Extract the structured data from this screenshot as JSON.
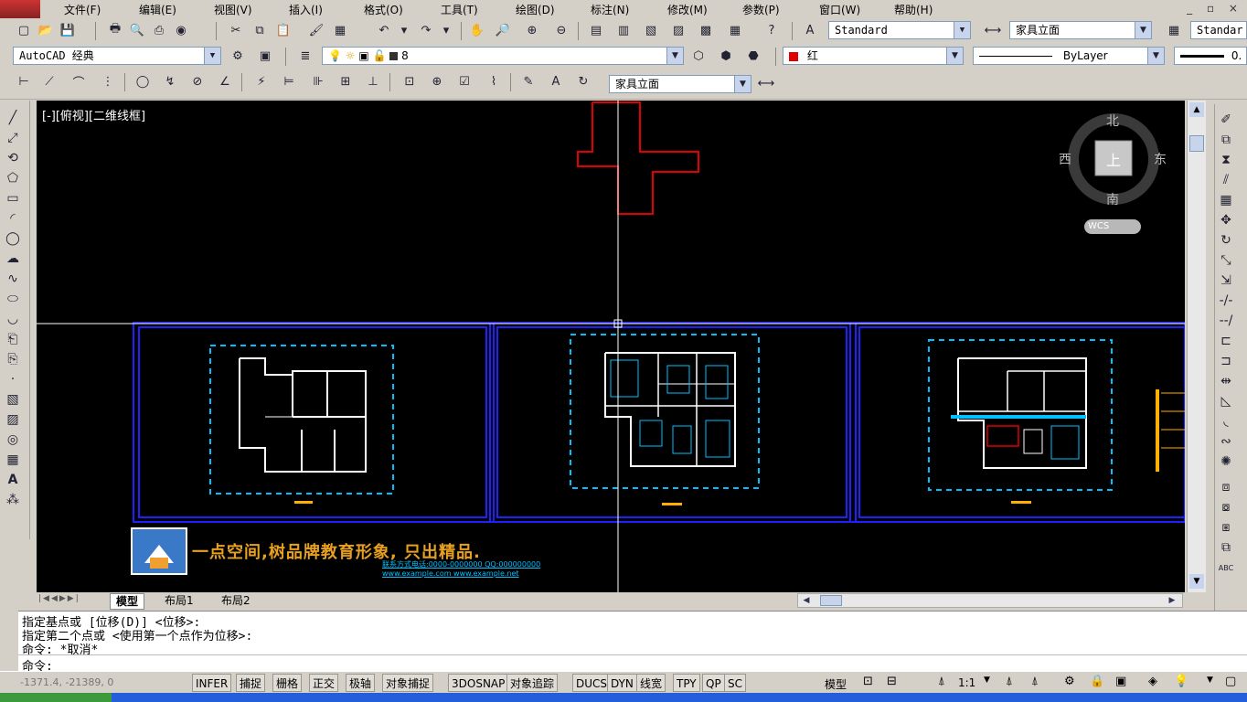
{
  "menu": {
    "items": [
      "文件(F)",
      "编辑(E)",
      "视图(V)",
      "插入(I)",
      "格式(O)",
      "工具(T)",
      "绘图(D)",
      "标注(N)",
      "修改(M)",
      "参数(P)",
      "窗口(W)",
      "帮助(H)"
    ],
    "window_controls": "_ ▫ ×"
  },
  "toolbar": {
    "text_style": "Standard",
    "dim_style": "家具立面",
    "table_style": "Standar",
    "workspace": "AutoCAD 经典",
    "layer": "8",
    "color": "红",
    "linetype": "ByLayer",
    "lineweight": "0.",
    "multileader_style": "家具立面",
    "colors": {
      "red": "#e00000",
      "canvas": "#000000",
      "cyan": "#00c0ff",
      "blue": "#2020ff"
    }
  },
  "viewport": {
    "label": "[-][俯视][二维线框]",
    "compass": {
      "north": "北",
      "south": "南",
      "east": "东",
      "west": "西",
      "top": "上",
      "wcs": "WCS"
    }
  },
  "drawing": {
    "slogan": "一点空间,树品牌教育形象, 只出精品.",
    "contact_line1": "联系方式电话:0000-0000000 QQ:000000000",
    "contact_line2": "www.example.com www.example.net"
  },
  "tabs": [
    "模型",
    "布局1",
    "布局2"
  ],
  "command": {
    "lines": [
      "指定基点或 [位移(D)] <位移>:",
      "指定第二个点或 <使用第一个点作为位移>:",
      "命令: *取消*",
      "命令:"
    ]
  },
  "status": {
    "coords": "-1371.4, -21389, 0",
    "buttons": [
      "INFER",
      "捕捉",
      "栅格",
      "正交",
      "极轴",
      "对象捕捉",
      "3DOSNAP",
      "对象追踪",
      "DUCS",
      "DYN",
      "线宽",
      "TPY",
      "QP",
      "SC"
    ],
    "model": "模型",
    "scale": "1:1"
  }
}
